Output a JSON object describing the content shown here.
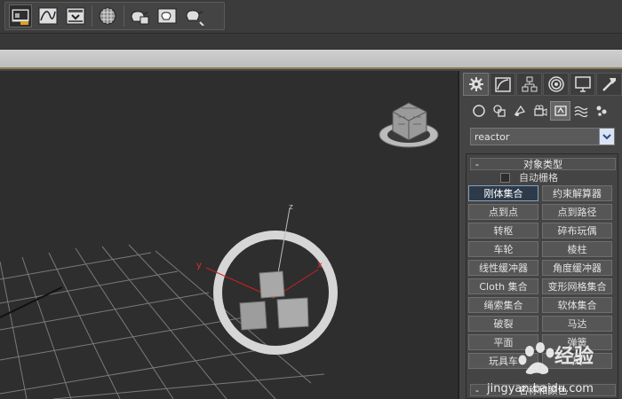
{
  "toolbar": {
    "buttons": [
      {
        "icon": "render-setup-icon"
      },
      {
        "icon": "curve-editor-icon"
      },
      {
        "icon": "rendered-frame-window-icon"
      },
      {
        "icon": "material-editor-icon"
      },
      {
        "icon": "render-production-icon"
      },
      {
        "icon": "render-iterative-icon"
      },
      {
        "icon": "render-activeshade-icon"
      }
    ]
  },
  "viewport": {
    "axis_labels": {
      "z": "z",
      "x": "x",
      "y": "y"
    }
  },
  "command_panel": {
    "main_tabs": [
      "create-tab-icon",
      "modify-tab-icon",
      "hierarchy-tab-icon",
      "motion-tab-icon",
      "display-tab-icon",
      "utilities-tab-icon"
    ],
    "sub_tabs": [
      "geometry-icon",
      "shapes-icon",
      "lights-icon",
      "cameras-icon",
      "helpers-icon",
      "space-warps-icon",
      "systems-icon"
    ],
    "category_dropdown": {
      "value": "reactor"
    },
    "object_type_rollout": {
      "toggle": "-",
      "title": "对象类型",
      "autogrid_label": "自动栅格",
      "buttons": [
        "刚体集合",
        "约束解算器",
        "点到点",
        "点到路径",
        "转枢",
        "碎布玩偶",
        "车轮",
        "棱柱",
        "线性缓冲器",
        "角度缓冲器",
        "Cloth 集合",
        "变形网格集合",
        "绳索集合",
        "软体集合",
        "破裂",
        "马达",
        "平面",
        "弹簧",
        "玩具车",
        "风"
      ],
      "active_button": "刚体集合"
    },
    "name_color_rollout": {
      "toggle": "-",
      "title": "名称和颜色"
    }
  },
  "watermark": {
    "brand": "经验",
    "url": "jingyan.baidu.com"
  },
  "colors": {
    "viewport_bg": "#2e2e2e",
    "panel_bg": "#444444",
    "active_button_bg": "#2c3a4a",
    "axis_red": "#d42020"
  }
}
